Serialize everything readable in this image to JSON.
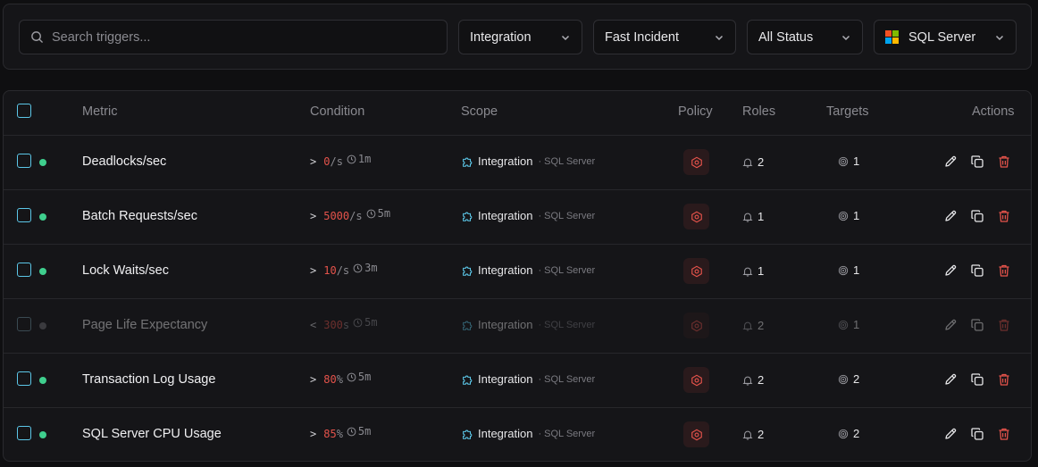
{
  "filters": {
    "search_placeholder": "Search triggers...",
    "type": "Integration",
    "policy": "Fast Incident",
    "status": "All Status",
    "integration": "SQL Server"
  },
  "table": {
    "headers": {
      "metric": "Metric",
      "condition": "Condition",
      "scope": "Scope",
      "policy": "Policy",
      "roles": "Roles",
      "targets": "Targets",
      "actions": "Actions"
    },
    "rows": [
      {
        "metric": "Deadlocks/sec",
        "op": ">",
        "value": "0",
        "unit": "/s",
        "duration": "1m",
        "scope": "Integration",
        "scope_sub": "· SQL Server",
        "roles": "2",
        "targets": "1",
        "active": true
      },
      {
        "metric": "Batch Requests/sec",
        "op": ">",
        "value": "5000",
        "unit": "/s",
        "duration": "5m",
        "scope": "Integration",
        "scope_sub": "· SQL Server",
        "roles": "1",
        "targets": "1",
        "active": true
      },
      {
        "metric": "Lock Waits/sec",
        "op": ">",
        "value": "10",
        "unit": "/s",
        "duration": "3m",
        "scope": "Integration",
        "scope_sub": "· SQL Server",
        "roles": "1",
        "targets": "1",
        "active": true
      },
      {
        "metric": "Page Life Expectancy",
        "op": "<",
        "value": "300",
        "unit": "s",
        "duration": "5m",
        "scope": "Integration",
        "scope_sub": "· SQL Server",
        "roles": "2",
        "targets": "1",
        "active": false
      },
      {
        "metric": "Transaction Log Usage",
        "op": ">",
        "value": "80",
        "unit": "%",
        "duration": "5m",
        "scope": "Integration",
        "scope_sub": "· SQL Server",
        "roles": "2",
        "targets": "2",
        "active": true
      },
      {
        "metric": "SQL Server CPU Usage",
        "op": ">",
        "value": "85",
        "unit": "%",
        "duration": "5m",
        "scope": "Integration",
        "scope_sub": "· SQL Server",
        "roles": "2",
        "targets": "2",
        "active": true
      }
    ]
  },
  "colors": {
    "accent_checkbox": "#5cc7e8",
    "active_dot": "#3fcf8e",
    "danger": "#e5534b"
  }
}
